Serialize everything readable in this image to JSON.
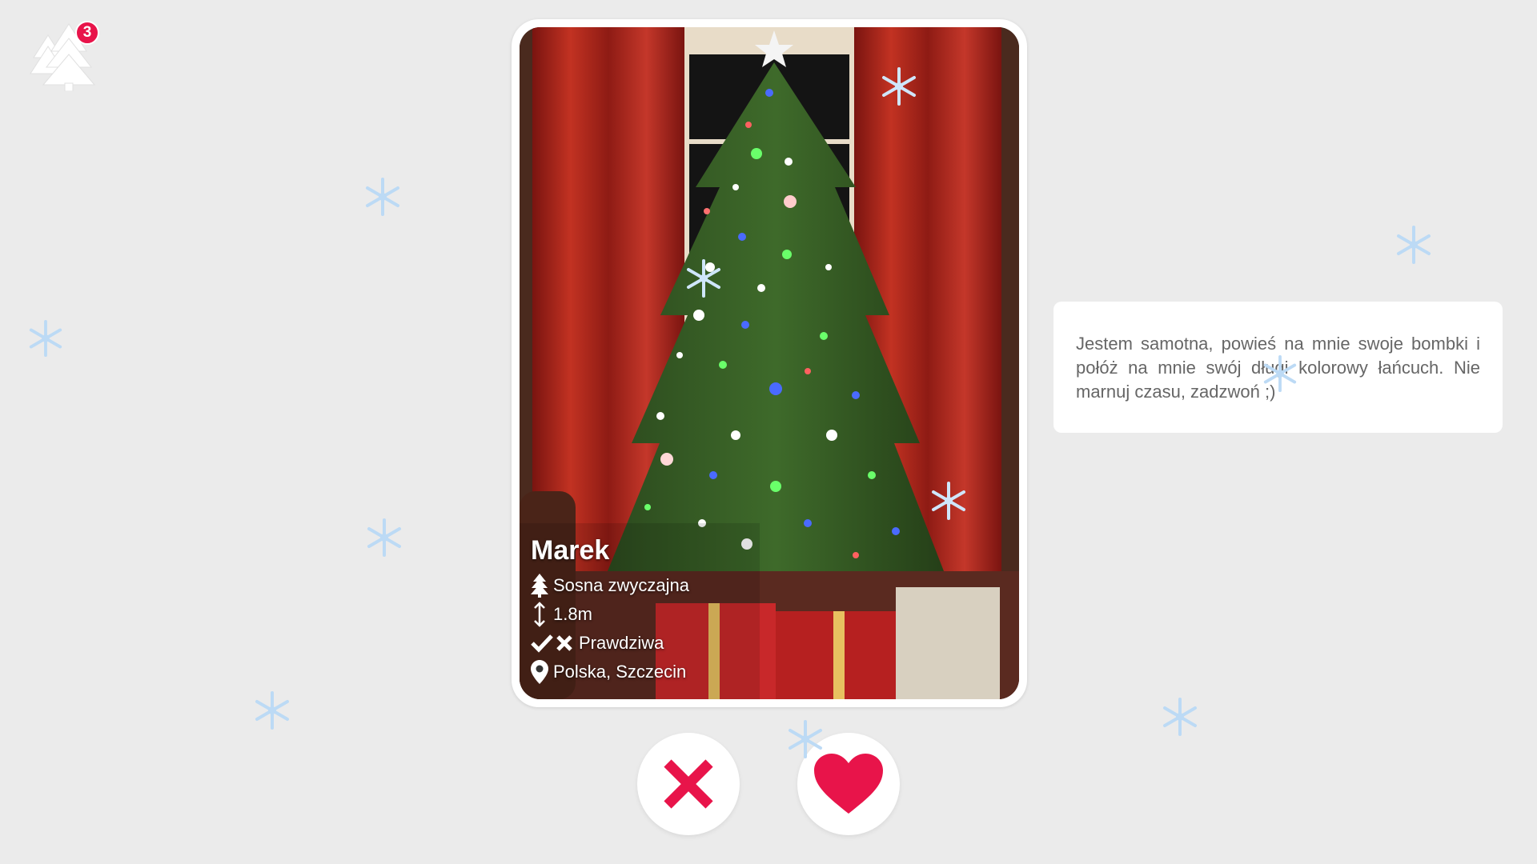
{
  "app": {
    "notification_count": "3"
  },
  "profile": {
    "name": "Marek",
    "species": "Sosna zwyczajna",
    "height": "1.8m",
    "type": "Prawdziwa",
    "location": "Polska, Szczecin",
    "description": "Jestem samotna, powieś na mnie swoje bombki i połóż na mnie swój długi kolorowy łańcuch. Nie marnuj czasu, zadzwoń ;)"
  },
  "actions": {
    "dislike_icon": "close-icon",
    "like_icon": "heart-icon"
  },
  "colors": {
    "accent": "#e8144a",
    "background": "#ebebeb",
    "snowflake": "#bcdaf5"
  }
}
